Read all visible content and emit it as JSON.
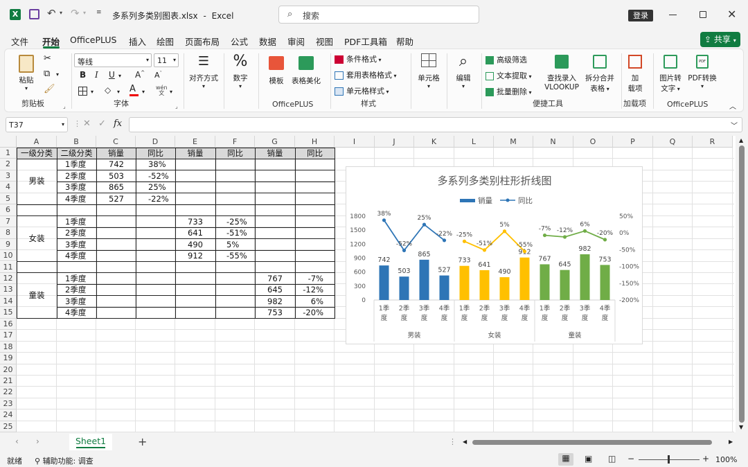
{
  "titlebar": {
    "filename": "多系列多类别图表.xlsx",
    "separator": "-",
    "app": "Excel",
    "search_placeholder": "搜索",
    "login": "登录"
  },
  "menu": [
    "文件",
    "开始",
    "OfficePLUS",
    "插入",
    "绘图",
    "页面布局",
    "公式",
    "数据",
    "审阅",
    "视图",
    "PDF工具箱",
    "帮助"
  ],
  "share": "共享",
  "ribbon": {
    "paste": "粘贴",
    "clipboard": "剪贴板",
    "font_name": "等线",
    "font_size": "11",
    "font_group": "字体",
    "bold": "B",
    "italic": "I",
    "underline": "U",
    "grow": "A",
    "shrink": "A",
    "font_color": "A",
    "align": "对齐方式",
    "number": "数字",
    "template": "模板",
    "beautify": "表格美化",
    "officeplus": "OfficePLUS",
    "cond_format": "条件格式",
    "table_format": "套用表格格式",
    "cell_style": "单元格样式",
    "style_group": "样式",
    "cells": "单元格",
    "edit": "编辑",
    "adv_filter": "高级筛选",
    "text_extract": "文本提取",
    "batch_delete": "批量删除",
    "lookup": "查找录入",
    "vlookup": "VLOOKUP",
    "split_merge": "拆分合并",
    "table": "表格",
    "quick_tools": "便捷工具",
    "addin1": "加",
    "addin2": "载项",
    "addin_group": "加载项",
    "img2text1": "图片转",
    "img2text2": "文字",
    "pdfconv": "PDF转换",
    "officeplus2": "OfficePLUS"
  },
  "namebox": "T37",
  "fx": "fx",
  "columns": [
    "A",
    "B",
    "C",
    "D",
    "E",
    "F",
    "G",
    "H",
    "I",
    "J",
    "K",
    "L",
    "M",
    "N",
    "O",
    "P",
    "Q",
    "R"
  ],
  "rows": [
    "1",
    "2",
    "3",
    "4",
    "5",
    "6",
    "7",
    "8",
    "9",
    "10",
    "11",
    "12",
    "13",
    "14",
    "15",
    "16",
    "17",
    "18",
    "19",
    "20",
    "21",
    "22",
    "23",
    "24",
    "25"
  ],
  "table": {
    "headers": [
      "一级分类",
      "二级分类",
      "销量",
      "同比",
      "销量",
      "同比",
      "销量",
      "同比"
    ],
    "groups": [
      "男装",
      "女装",
      "童装"
    ],
    "quarters": [
      "1季度",
      "2季度",
      "3季度",
      "4季度"
    ],
    "men": {
      "sales": [
        "742",
        "503",
        "865",
        "527"
      ],
      "yoy": [
        "38%",
        "-52%",
        "25%",
        "-22%"
      ]
    },
    "women": {
      "sales": [
        "733",
        "641",
        "490",
        "912"
      ],
      "yoy": [
        "-25%",
        "-51%",
        "5%",
        "-55%"
      ]
    },
    "kids": {
      "sales": [
        "767",
        "645",
        "982",
        "753"
      ],
      "yoy": [
        "-7%",
        "-12%",
        "6%",
        "-20%"
      ]
    }
  },
  "chart_data": {
    "type": "bar",
    "title": "多系列多类别柱形折线图",
    "legend": [
      "销量",
      "同比"
    ],
    "legend_position": "top",
    "groups": [
      "男装",
      "女装",
      "童装"
    ],
    "categories": [
      "1季度",
      "2季度",
      "3季度",
      "4季度"
    ],
    "y_ticks": [
      "1800",
      "1500",
      "1200",
      "900",
      "600",
      "300",
      "0"
    ],
    "y2_ticks": [
      "50%",
      "0%",
      "-50%",
      "-100%",
      "-150%",
      "-200%"
    ],
    "ylim": [
      0,
      1800
    ],
    "y2lim": [
      -200,
      50
    ],
    "series": [
      {
        "group": "男装",
        "color": "#2e75b6",
        "sales": [
          742,
          503,
          865,
          527
        ],
        "yoy": [
          38,
          -52,
          25,
          -22
        ],
        "sales_labels": [
          "742",
          "503",
          "865",
          "527"
        ],
        "yoy_labels": [
          "38%",
          "-52%",
          "25%",
          "-22%"
        ]
      },
      {
        "group": "女装",
        "color": "#ffc000",
        "sales": [
          733,
          641,
          490,
          912
        ],
        "yoy": [
          -25,
          -51,
          5,
          -55
        ],
        "sales_labels": [
          "733",
          "641",
          "490",
          "912"
        ],
        "yoy_labels": [
          "-25%",
          "-51%",
          "5%",
          "-55%"
        ]
      },
      {
        "group": "童装",
        "color": "#70ad47",
        "sales": [
          767,
          645,
          982,
          753
        ],
        "yoy": [
          -7,
          -12,
          6,
          -20
        ],
        "sales_labels": [
          "767",
          "645",
          "982",
          "753"
        ],
        "yoy_labels": [
          "-7%",
          "-12%",
          "6%",
          "-20%"
        ]
      }
    ],
    "grid": false
  },
  "tabs": {
    "sheet": "Sheet1",
    "add": "+"
  },
  "status": {
    "ready": "就绪",
    "accessibility": "辅助功能: 调查",
    "zoom": "100%"
  },
  "colors": {
    "excel_green": "#107c41",
    "men": "#2e75b6",
    "women": "#ffc000",
    "kids": "#70ad47"
  }
}
